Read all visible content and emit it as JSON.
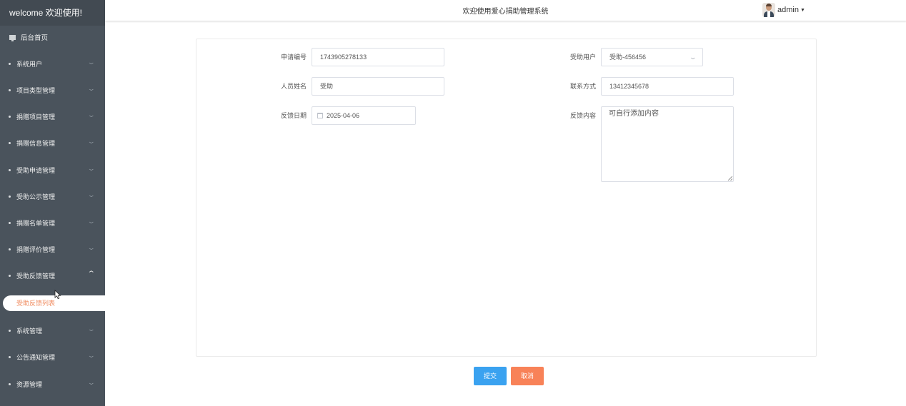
{
  "sidebar": {
    "welcome": "welcome 欢迎使用!",
    "home": "后台首页",
    "items": [
      {
        "label": "系统用户",
        "expanded": false
      },
      {
        "label": "项目类型管理",
        "expanded": false
      },
      {
        "label": "捐赠项目管理",
        "expanded": false
      },
      {
        "label": "捐赠信息管理",
        "expanded": false
      },
      {
        "label": "受助申请管理",
        "expanded": false
      },
      {
        "label": "受助公示管理",
        "expanded": false
      },
      {
        "label": "捐赠名单管理",
        "expanded": false
      },
      {
        "label": "捐赠评价管理",
        "expanded": false
      },
      {
        "label": "受助反馈管理",
        "expanded": true
      },
      {
        "label": "系统管理",
        "expanded": false
      },
      {
        "label": "公告通知管理",
        "expanded": false
      },
      {
        "label": "资源管理",
        "expanded": false
      }
    ],
    "active_sub": "受助反馈列表"
  },
  "header": {
    "title": "欢迎使用爱心捐助管理系统",
    "user": "admin"
  },
  "form": {
    "application_no_label": "申请编号",
    "application_no": "1743905278133",
    "aided_user_label": "受助用户",
    "aided_user": "受助-456456",
    "person_name_label": "人员姓名",
    "person_name": "受助",
    "contact_label": "联系方式",
    "contact": "13412345678",
    "feedback_date_label": "反馈日期",
    "feedback_date": "2025-04-06",
    "feedback_content_label": "反馈内容",
    "feedback_content": "可自行添加内容"
  },
  "buttons": {
    "submit": "提交",
    "cancel": "取消"
  },
  "colors": {
    "sidebar_bg": "#4a535c",
    "accent_blue": "#3aa2f0",
    "accent_orange": "#f88258",
    "active_text": "#f08a5d"
  }
}
